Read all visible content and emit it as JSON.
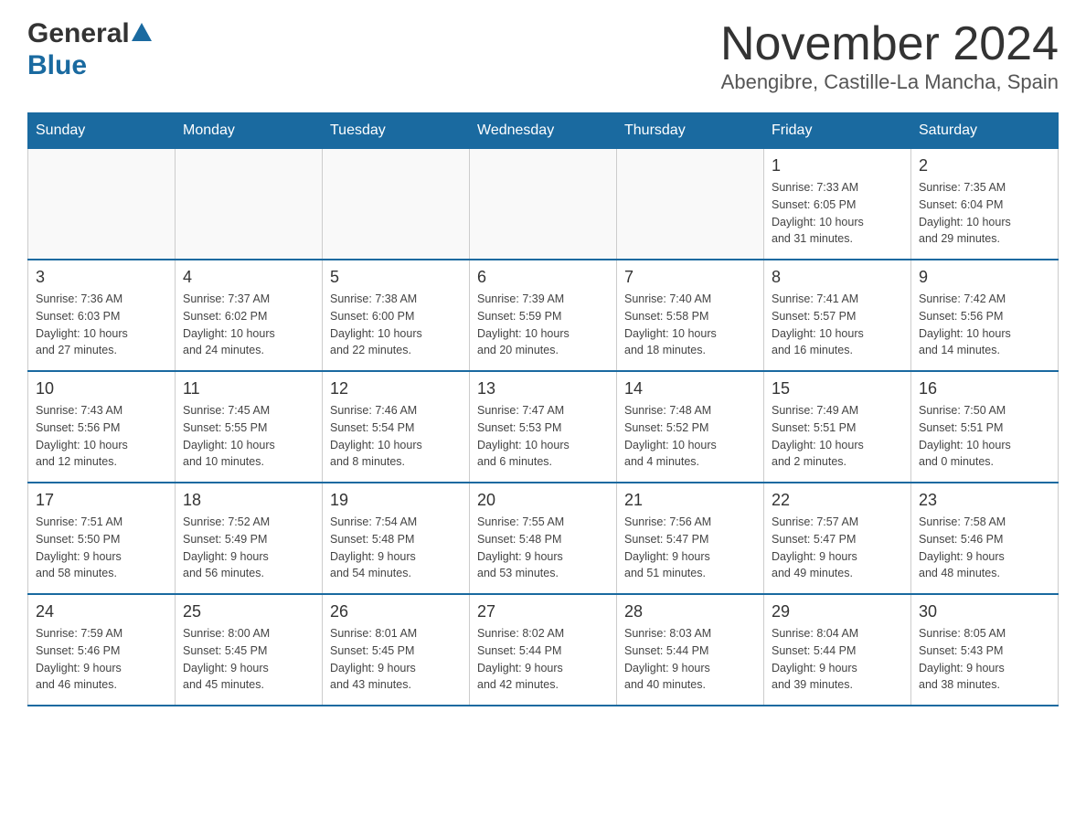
{
  "header": {
    "logo_general": "General",
    "logo_blue": "Blue",
    "month_title": "November 2024",
    "location": "Abengibre, Castille-La Mancha, Spain"
  },
  "days_of_week": [
    "Sunday",
    "Monday",
    "Tuesday",
    "Wednesday",
    "Thursday",
    "Friday",
    "Saturday"
  ],
  "weeks": [
    [
      {
        "day": "",
        "info": ""
      },
      {
        "day": "",
        "info": ""
      },
      {
        "day": "",
        "info": ""
      },
      {
        "day": "",
        "info": ""
      },
      {
        "day": "",
        "info": ""
      },
      {
        "day": "1",
        "info": "Sunrise: 7:33 AM\nSunset: 6:05 PM\nDaylight: 10 hours\nand 31 minutes."
      },
      {
        "day": "2",
        "info": "Sunrise: 7:35 AM\nSunset: 6:04 PM\nDaylight: 10 hours\nand 29 minutes."
      }
    ],
    [
      {
        "day": "3",
        "info": "Sunrise: 7:36 AM\nSunset: 6:03 PM\nDaylight: 10 hours\nand 27 minutes."
      },
      {
        "day": "4",
        "info": "Sunrise: 7:37 AM\nSunset: 6:02 PM\nDaylight: 10 hours\nand 24 minutes."
      },
      {
        "day": "5",
        "info": "Sunrise: 7:38 AM\nSunset: 6:00 PM\nDaylight: 10 hours\nand 22 minutes."
      },
      {
        "day": "6",
        "info": "Sunrise: 7:39 AM\nSunset: 5:59 PM\nDaylight: 10 hours\nand 20 minutes."
      },
      {
        "day": "7",
        "info": "Sunrise: 7:40 AM\nSunset: 5:58 PM\nDaylight: 10 hours\nand 18 minutes."
      },
      {
        "day": "8",
        "info": "Sunrise: 7:41 AM\nSunset: 5:57 PM\nDaylight: 10 hours\nand 16 minutes."
      },
      {
        "day": "9",
        "info": "Sunrise: 7:42 AM\nSunset: 5:56 PM\nDaylight: 10 hours\nand 14 minutes."
      }
    ],
    [
      {
        "day": "10",
        "info": "Sunrise: 7:43 AM\nSunset: 5:56 PM\nDaylight: 10 hours\nand 12 minutes."
      },
      {
        "day": "11",
        "info": "Sunrise: 7:45 AM\nSunset: 5:55 PM\nDaylight: 10 hours\nand 10 minutes."
      },
      {
        "day": "12",
        "info": "Sunrise: 7:46 AM\nSunset: 5:54 PM\nDaylight: 10 hours\nand 8 minutes."
      },
      {
        "day": "13",
        "info": "Sunrise: 7:47 AM\nSunset: 5:53 PM\nDaylight: 10 hours\nand 6 minutes."
      },
      {
        "day": "14",
        "info": "Sunrise: 7:48 AM\nSunset: 5:52 PM\nDaylight: 10 hours\nand 4 minutes."
      },
      {
        "day": "15",
        "info": "Sunrise: 7:49 AM\nSunset: 5:51 PM\nDaylight: 10 hours\nand 2 minutes."
      },
      {
        "day": "16",
        "info": "Sunrise: 7:50 AM\nSunset: 5:51 PM\nDaylight: 10 hours\nand 0 minutes."
      }
    ],
    [
      {
        "day": "17",
        "info": "Sunrise: 7:51 AM\nSunset: 5:50 PM\nDaylight: 9 hours\nand 58 minutes."
      },
      {
        "day": "18",
        "info": "Sunrise: 7:52 AM\nSunset: 5:49 PM\nDaylight: 9 hours\nand 56 minutes."
      },
      {
        "day": "19",
        "info": "Sunrise: 7:54 AM\nSunset: 5:48 PM\nDaylight: 9 hours\nand 54 minutes."
      },
      {
        "day": "20",
        "info": "Sunrise: 7:55 AM\nSunset: 5:48 PM\nDaylight: 9 hours\nand 53 minutes."
      },
      {
        "day": "21",
        "info": "Sunrise: 7:56 AM\nSunset: 5:47 PM\nDaylight: 9 hours\nand 51 minutes."
      },
      {
        "day": "22",
        "info": "Sunrise: 7:57 AM\nSunset: 5:47 PM\nDaylight: 9 hours\nand 49 minutes."
      },
      {
        "day": "23",
        "info": "Sunrise: 7:58 AM\nSunset: 5:46 PM\nDaylight: 9 hours\nand 48 minutes."
      }
    ],
    [
      {
        "day": "24",
        "info": "Sunrise: 7:59 AM\nSunset: 5:46 PM\nDaylight: 9 hours\nand 46 minutes."
      },
      {
        "day": "25",
        "info": "Sunrise: 8:00 AM\nSunset: 5:45 PM\nDaylight: 9 hours\nand 45 minutes."
      },
      {
        "day": "26",
        "info": "Sunrise: 8:01 AM\nSunset: 5:45 PM\nDaylight: 9 hours\nand 43 minutes."
      },
      {
        "day": "27",
        "info": "Sunrise: 8:02 AM\nSunset: 5:44 PM\nDaylight: 9 hours\nand 42 minutes."
      },
      {
        "day": "28",
        "info": "Sunrise: 8:03 AM\nSunset: 5:44 PM\nDaylight: 9 hours\nand 40 minutes."
      },
      {
        "day": "29",
        "info": "Sunrise: 8:04 AM\nSunset: 5:44 PM\nDaylight: 9 hours\nand 39 minutes."
      },
      {
        "day": "30",
        "info": "Sunrise: 8:05 AM\nSunset: 5:43 PM\nDaylight: 9 hours\nand 38 minutes."
      }
    ]
  ]
}
